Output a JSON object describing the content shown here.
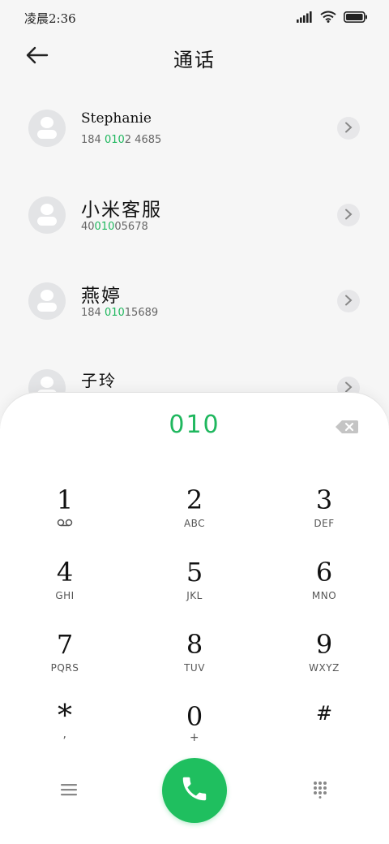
{
  "status_bar": {
    "time": "凌晨2:36",
    "icons": [
      "signal-icon",
      "wifi-icon",
      "battery-icon"
    ]
  },
  "header": {
    "title": "通话",
    "back_icon": "back-arrow-icon"
  },
  "contacts": [
    {
      "name": "Stephanie",
      "number_parts": [
        "184 ",
        "010",
        "2 4685"
      ]
    },
    {
      "name": "小米客服",
      "number_parts": [
        "40",
        "010",
        "05678"
      ]
    },
    {
      "name": "燕婷",
      "number_parts": [
        "184 ",
        "010",
        "15689"
      ]
    },
    {
      "name": "子玲",
      "number_parts": [
        "",
        "",
        ""
      ]
    }
  ],
  "dialpad": {
    "input_value": "010",
    "keys": [
      {
        "digit": "1",
        "letters": "voicemail-icon"
      },
      {
        "digit": "2",
        "letters": "ABC"
      },
      {
        "digit": "3",
        "letters": "DEF"
      },
      {
        "digit": "4",
        "letters": "GHI"
      },
      {
        "digit": "5",
        "letters": "JKL"
      },
      {
        "digit": "6",
        "letters": "MNO"
      },
      {
        "digit": "7",
        "letters": "PQRS"
      },
      {
        "digit": "8",
        "letters": "TUV"
      },
      {
        "digit": "9",
        "letters": "WXYZ"
      },
      {
        "digit": "*",
        "letters": ","
      },
      {
        "digit": "0",
        "letters": "+"
      },
      {
        "digit": "#",
        "letters": ""
      }
    ]
  },
  "bottom_bar": {
    "icons": [
      "menu-icon",
      "phone-icon",
      "keypad-icon"
    ]
  },
  "colors": {
    "accent_green": "#1fb75e",
    "call_button": "#1fbf5f",
    "avatar_bg": "#e3e4e6"
  }
}
